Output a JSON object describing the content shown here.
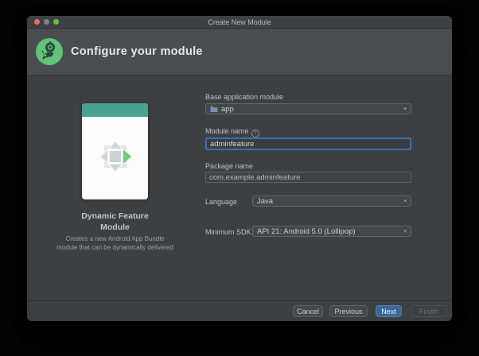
{
  "window": {
    "title": "Create New Module",
    "header": {
      "title": "Configure your module"
    }
  },
  "left_panel": {
    "title": "Dynamic Feature Module",
    "description": "Creates a new Android App Bundle module that can be dynamically delivered"
  },
  "form": {
    "base_application_module": {
      "label": "Base application module",
      "value": "app"
    },
    "module_name": {
      "label": "Module name",
      "help": "?",
      "value": "adminfeature"
    },
    "package_name": {
      "label": "Package name",
      "value": "com.example.adminfeature"
    },
    "language": {
      "label": "Language",
      "value": "Java"
    },
    "minimum_sdk": {
      "label": "Minimum SDK",
      "value": "API 21: Android 5.0 (Lollipop)"
    }
  },
  "footer": {
    "buttons": [
      {
        "label": "Cancel",
        "enabled": true
      },
      {
        "label": "Previous",
        "enabled": true
      },
      {
        "label": "Next",
        "enabled": true,
        "primary": true
      },
      {
        "label": "Finish",
        "enabled": false
      }
    ]
  },
  "icons": {
    "dropdown_arrow": "▾"
  },
  "colors": {
    "primary_button_blue": "#3a679a",
    "focus_border_blue": "#3d6fa8",
    "card_teal": "#4aa390",
    "android_green": "#63c178",
    "feature_green": "#6dd077"
  }
}
